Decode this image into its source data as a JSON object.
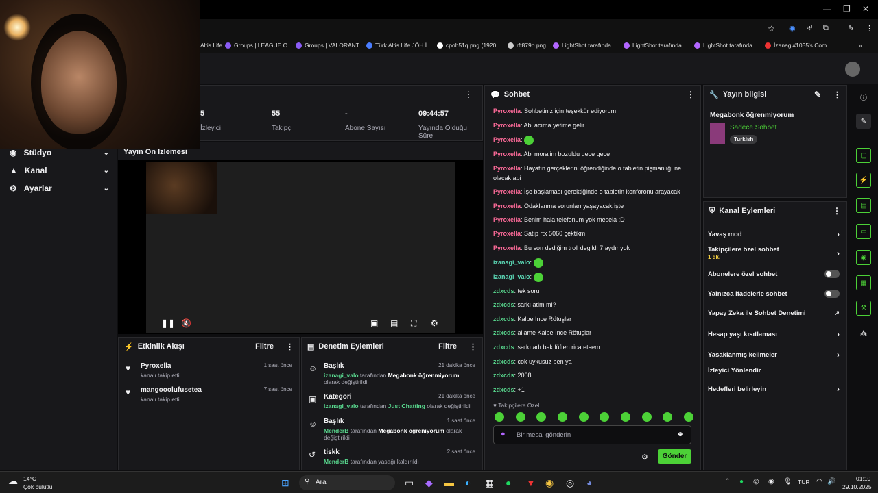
{
  "window": {
    "minimize": "—",
    "restore": "❐",
    "close": "✕"
  },
  "bookmarks": [
    {
      "label": "Altis Life",
      "color": "#888"
    },
    {
      "label": "Groups | LEAGUE O...",
      "color": "#8b5cf6"
    },
    {
      "label": "Groups | VALORANT...",
      "color": "#8b5cf6"
    },
    {
      "label": "Türk Altis Life JÖH İ...",
      "color": "#4a7dff"
    },
    {
      "label": "cpoh51q.png (1920...",
      "color": "#fff"
    },
    {
      "label": "rft879o.png",
      "color": "#fff"
    },
    {
      "label": "LightShot tarafında...",
      "color": "#b266ff"
    },
    {
      "label": "LightShot tarafında...",
      "color": "#b266ff"
    },
    {
      "label": "LightShot tarafında...",
      "color": "#b266ff"
    },
    {
      "label": "İzanagi#1035's Com...",
      "color": "#e33"
    }
  ],
  "sidebar": {
    "items": [
      {
        "label": "Stüdyo",
        "icon": "studio-icon"
      },
      {
        "label": "Kanal",
        "icon": "channel-icon"
      },
      {
        "label": "Ayarlar",
        "icon": "settings-icon"
      }
    ]
  },
  "stats": {
    "viewers_label": "İzleyici",
    "viewers_value": "5",
    "followers_value": "55",
    "followers_label": "Takipçi",
    "subs_value": "-",
    "subs_label": "Abone Sayısı",
    "uptime_value": "09:44:57",
    "uptime_label": "Yayında Olduğu Süre"
  },
  "preview": {
    "title": "Yayın Ön İzlemesi"
  },
  "activity": {
    "title": "Etkinlik Akışı",
    "filter": "Filtre",
    "events": [
      {
        "user": "Pyroxella",
        "text": "kanalı takip etti",
        "time": "1 saat önce"
      },
      {
        "user": "mangooolufusetea",
        "text": "kanalı takip etti",
        "time": "7 saat önce"
      }
    ]
  },
  "moderation": {
    "title": "Denetim Eylemleri",
    "filter": "Filtre",
    "events": [
      {
        "title": "Başlık",
        "time": "21 dakika önce",
        "actor": "izanagi_valo",
        "mid": "tarafından",
        "value": "Megabonk öğrenmiyorum",
        "tail": "olarak değiştirildi"
      },
      {
        "title": "Kategori",
        "time": "21 dakika önce",
        "actor": "izanagi_valo",
        "mid": "tarafından",
        "value": "Just Chatting",
        "tail": "olarak değiştirildi"
      },
      {
        "title": "Başlık",
        "time": "1 saat önce",
        "actor": "MenderB",
        "mid": "tarafından",
        "value": "Megabonk öğreniyorum",
        "tail": "olarak değiştirildi"
      },
      {
        "title": "tiskk",
        "time": "2 saat önce",
        "actor": "MenderB",
        "mid": "tarafından yasağı kaldırıldı",
        "value": "",
        "tail": ""
      }
    ]
  },
  "chat": {
    "title": "Sohbet",
    "messages": [
      {
        "user": "Pyroxella",
        "text": "Sohbetiniz için teşekkür ediyorum",
        "c": "u1"
      },
      {
        "user": "Pyroxella",
        "text": "Abi acıma yetime gelir",
        "c": "u1"
      },
      {
        "user": "Pyroxella",
        "text": "",
        "c": "u1",
        "emote": true
      },
      {
        "user": "Pyroxella",
        "text": "Abi moralim bozuldu gece gece",
        "c": "u1"
      },
      {
        "user": "Pyroxella",
        "text": "Hayatın gerçeklerini öğrendiğinde o tabletin pişmanlığı ne olacak abi",
        "c": "u1"
      },
      {
        "user": "Pyroxella",
        "text": "İşe başlaması gerektiğinde o tabletin konforonu arayacak",
        "c": "u1"
      },
      {
        "user": "Pyroxella",
        "text": "Odaklanma sorunları yaşayacak işte",
        "c": "u1"
      },
      {
        "user": "Pyroxella",
        "text": "Benim hala telefonum yok mesela :D",
        "c": "u1"
      },
      {
        "user": "Pyroxella",
        "text": "Satıp rtx 5060 çektikm",
        "c": "u1"
      },
      {
        "user": "Pyroxella",
        "text": "Bu son dediğim troll degildi 7 aydır yok",
        "c": "u1"
      },
      {
        "user": "izanagi_valo",
        "text": "",
        "c": "u2",
        "emote": true
      },
      {
        "user": "izanagi_valo",
        "text": "",
        "c": "u2",
        "emote": true
      },
      {
        "user": "zdxcds",
        "text": "tek soru",
        "c": "u3"
      },
      {
        "user": "zdxcds",
        "text": "sarkı atim mi?",
        "c": "u3"
      },
      {
        "user": "zdxcds",
        "text": "Kalbe İnce Rötuşlar",
        "c": "u3"
      },
      {
        "user": "zdxcds",
        "text": "allame Kalbe İnce Rötuşlar",
        "c": "u3"
      },
      {
        "user": "zdxcds",
        "text": "sarkı adı bak lüften rica etsem",
        "c": "u3"
      },
      {
        "user": "zdxcds",
        "text": "cok uykusuz ben ya",
        "c": "u3"
      },
      {
        "user": "zdxcds",
        "text": "2008",
        "c": "u3"
      },
      {
        "user": "zdxcds",
        "text": "+1",
        "c": "u3"
      }
    ],
    "followers_only": "Takipçilere Özel",
    "placeholder": "Bir mesaj gönderin",
    "send": "Gönder"
  },
  "streaminfo": {
    "title": "Yayın bilgisi",
    "stream_title": "Megabonk öğrenmiyorum",
    "category": "Sadece Sohbet",
    "tag": "Turkish"
  },
  "channelactions": {
    "title": "Kanal Eylemleri",
    "items": [
      {
        "label": "Yavaş mod",
        "kind": "arrow"
      },
      {
        "label": "Takipçilere özel sohbet",
        "sub": "1 dk.",
        "kind": "arrow"
      },
      {
        "label": "Abonelere özel sohbet",
        "kind": "toggle"
      },
      {
        "label": "Yalnızca ifadelerle sohbet",
        "kind": "toggle"
      },
      {
        "label": "Yapay Zeka ile Sohbet Denetimi",
        "kind": "ext"
      },
      {
        "label": "Hesap yaşı kısıtlaması",
        "kind": "arrow"
      },
      {
        "label": "Yasaklanmış kelimeler",
        "kind": "arrow"
      },
      {
        "label": "İzleyici Yönlendir",
        "kind": "none"
      },
      {
        "label": "Hedefleri belirleyin",
        "kind": "arrow"
      }
    ]
  },
  "taskbar": {
    "weather_temp": "14°C",
    "weather_desc": "Çok bulutlu",
    "search": "Ara",
    "lang": "TUR",
    "time": "01:10",
    "date": "29.10.2025"
  }
}
